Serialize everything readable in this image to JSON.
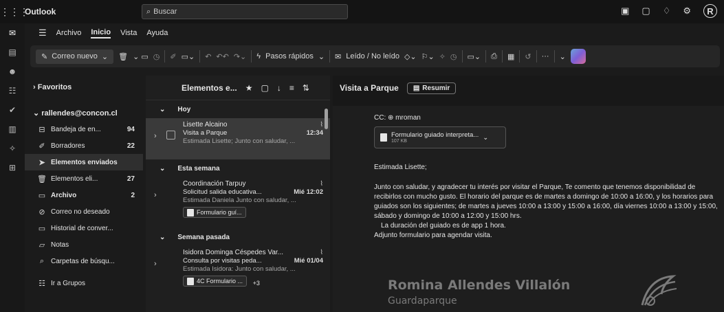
{
  "top": {
    "app_name": "Outlook",
    "search_placeholder": "Buscar",
    "avatar_initial": "R"
  },
  "menu": {
    "tabs": [
      "Archivo",
      "Inicio",
      "Vista",
      "Ayuda"
    ],
    "active_tab": "Inicio"
  },
  "ribbon": {
    "new_mail": "Correo nuevo",
    "quick_steps": "Pasos rápidos",
    "read_unread": "Leído / No leído"
  },
  "folders": {
    "favorites": "Favoritos",
    "account": "rallendes@concon.cl",
    "items": [
      {
        "label": "Bandeja de en...",
        "count": "94"
      },
      {
        "label": "Borradores",
        "count": "22"
      },
      {
        "label": "Elementos enviados",
        "count": ""
      },
      {
        "label": "Elementos eli...",
        "count": "27"
      },
      {
        "label": "Archivo",
        "count": "2"
      },
      {
        "label": "Correo no deseado",
        "count": ""
      },
      {
        "label": "Historial de conver...",
        "count": ""
      },
      {
        "label": "Notas",
        "count": ""
      },
      {
        "label": "Carpetas de búsqu...",
        "count": ""
      },
      {
        "label": "Ir a Grupos",
        "count": ""
      }
    ]
  },
  "list": {
    "title": "Elementos e...",
    "sections": [
      "Hoy",
      "Esta semana",
      "Semana pasada"
    ],
    "messages": [
      {
        "sender": "Lisette Alcaino",
        "subject": "Visita a Parque",
        "time": "12:34",
        "preview": "Estimada Lisette; Junto con saludar, ..."
      },
      {
        "sender": "Coordinación Tarpuy",
        "subject": "Solicitud salida educativa...",
        "time": "Mié 12:02",
        "preview": "Estimada Daniela Junto con saludar, ...",
        "attachment": "Formulario guí..."
      },
      {
        "sender": "Isidora Dominga Céspedes Var...",
        "subject": "Consulta por visitas peda...",
        "time": "Mié 01/04",
        "preview": "Estimada Isidora: Junto con saludar, ...",
        "attachment": "4C Formulario ...",
        "extra": "+3"
      }
    ]
  },
  "reading": {
    "subject": "Visita a Parque",
    "summarize": "Resumir",
    "cc": "CC: ⊕ mroman",
    "attachment_name": "Formulario guiado interpreta...",
    "attachment_size": "107 KB",
    "greeting": "Estimada Lisette;",
    "body": "Junto con saludar, y agradecer tu interés por visitar el Parque, Te comento que tenemos disponibilidad de recibirlos con mucho gusto. El horario del parque es de martes a domingo de 10:00 a 16:00, y los horarios para guiados son los siguientes; de martes a jueves 10:00 a 13:00 y 15:00 a 16:00, día viernes 10:00 a 13:00 y 15:00, sábado y domingo de 10:00 a 12:00 y 15:00 hrs.",
    "body_line2": "La duración del guiado es de app 1 hora.",
    "body_line3": "Adjunto formulario para agendar visita.",
    "signature_name": "Romina Allendes Villalón",
    "signature_role": "Guardaparque"
  }
}
